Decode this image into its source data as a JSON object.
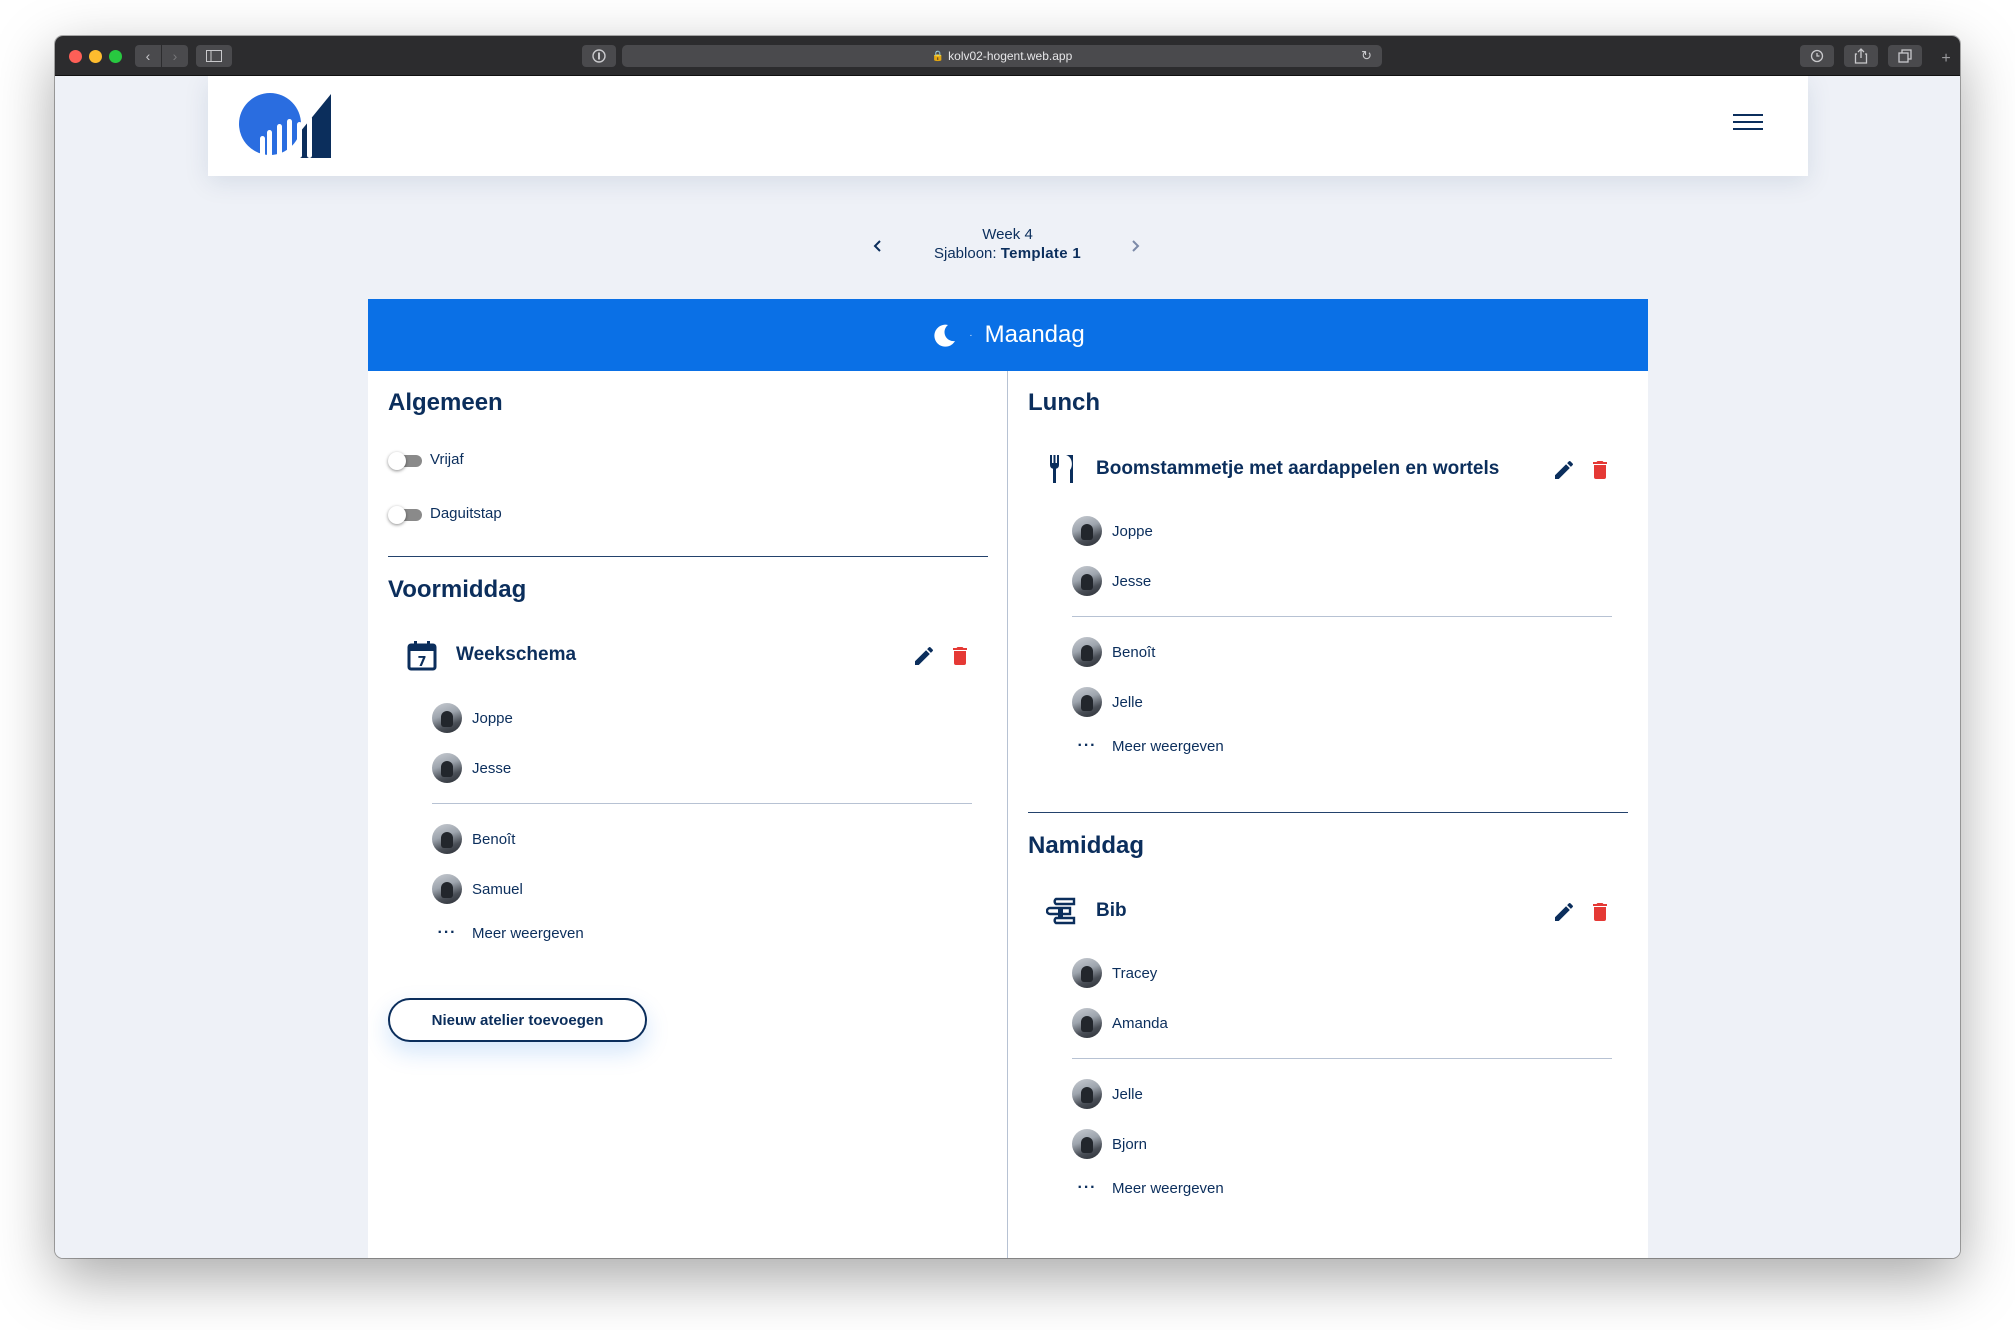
{
  "browser": {
    "url": "kolv02-hogent.web.app"
  },
  "nav": {
    "week": "Week 4",
    "template_prefix": "Sjabloon:",
    "template_name": "Template 1"
  },
  "day": {
    "name": "Maandag",
    "icon": "moon-icon",
    "header_color": "#0a70e6"
  },
  "algemeen": {
    "title": "Algemeen",
    "toggles": [
      {
        "label": "Vrijaf",
        "on": false
      },
      {
        "label": "Daguitstap",
        "on": false
      }
    ]
  },
  "voormiddag": {
    "title": "Voormiddag",
    "atelier": {
      "name": "Weekschema",
      "icon": "calendar-icon",
      "mentors": [
        "Joppe",
        "Jesse"
      ],
      "clients": [
        "Benoît",
        "Samuel"
      ],
      "more_label": "Meer weergeven"
    },
    "add_button": "Nieuw atelier toevoegen"
  },
  "lunch": {
    "title": "Lunch",
    "atelier": {
      "name": "Boomstammetje met aardappelen en wortels",
      "icon": "cutlery-icon",
      "mentors": [
        "Joppe",
        "Jesse"
      ],
      "clients": [
        "Benoît",
        "Jelle"
      ],
      "more_label": "Meer weergeven"
    }
  },
  "namiddag": {
    "title": "Namiddag",
    "atelier": {
      "name": "Bib",
      "icon": "books-icon",
      "mentors": [
        "Tracey",
        "Amanda"
      ],
      "clients": [
        "Jelle",
        "Bjorn"
      ],
      "more_label": "Meer weergeven"
    }
  },
  "colors": {
    "primary_dark": "#0b2e5c",
    "accent_blue": "#0a70e6",
    "delete_red": "#e53935"
  }
}
